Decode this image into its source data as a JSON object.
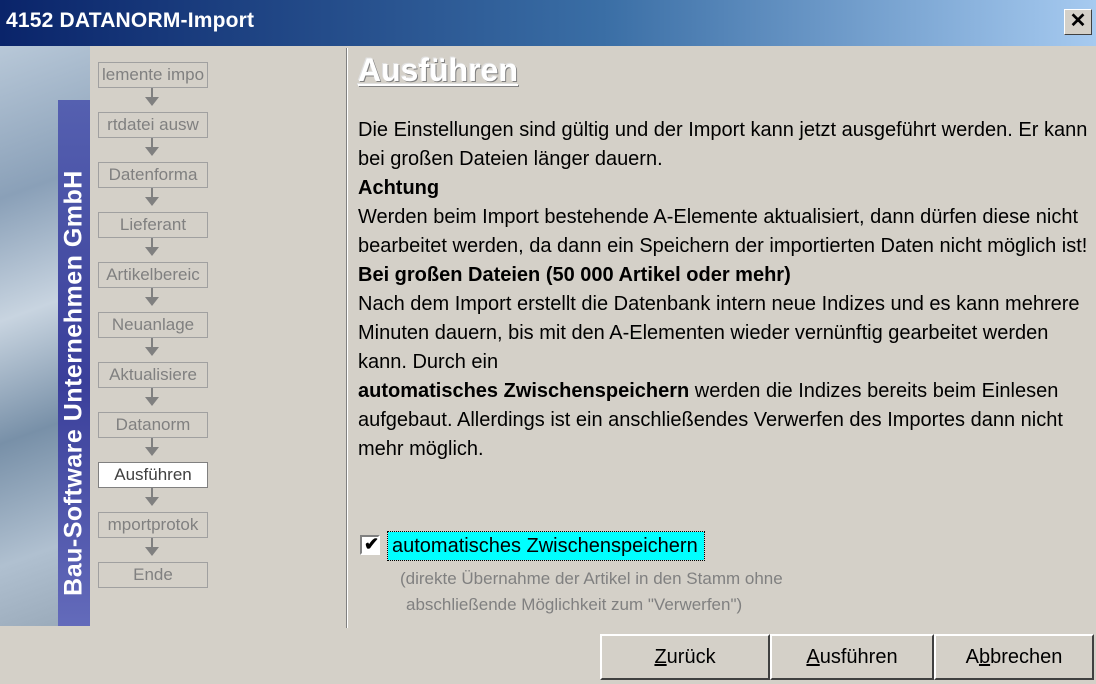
{
  "window": {
    "title": "4152 DATANORM-Import",
    "close_icon": "close-icon"
  },
  "sidebar": {
    "brand_text": "Bau-Software Unternehmen GmbH",
    "steps": [
      {
        "label": "lemente impo",
        "state": "disabled"
      },
      {
        "label": "rtdatei ausw",
        "state": "disabled"
      },
      {
        "label": "Datenforma",
        "state": "disabled"
      },
      {
        "label": "Lieferant",
        "state": "disabled"
      },
      {
        "label": "Artikelbereic",
        "state": "disabled"
      },
      {
        "label": "Neuanlage",
        "state": "disabled"
      },
      {
        "label": "Aktualisiere",
        "state": "disabled"
      },
      {
        "label": "Datanorm",
        "state": "disabled"
      },
      {
        "label": "Ausführen",
        "state": "active"
      },
      {
        "label": "mportprotok",
        "state": "disabled"
      },
      {
        "label": "Ende",
        "state": "disabled"
      }
    ]
  },
  "main": {
    "heading": "Ausführen",
    "para1": "Die Einstellungen sind gültig und der Import kann jetzt ausgeführt werden. Er kann bei großen Dateien länger dauern.",
    "attention_title": "Achtung",
    "para2": "Werden beim Import bestehende A-Elemente aktualisiert, dann dürfen diese nicht bearbeitet werden, da dann ein Speichern der importierten Daten nicht möglich ist!",
    "large_files_title": "Bei großen Dateien (50 000 Artikel oder mehr)",
    "para3_a": "Nach dem Import erstellt die Datenbank intern neue Indizes und es kann mehrere Minuten dauern, bis mit den A-Elementen wieder vernünftig gearbeitet werden kann. Durch ein",
    "para3_bold": "automatisches Zwischenspeichern",
    "para3_b": " werden die Indizes bereits beim Einlesen aufgebaut. Allerdings ist ein anschließendes Verwerfen des Importes dann nicht mehr möglich.",
    "checkbox": {
      "label": "automatisches Zwischenspeichern",
      "checked": true,
      "check_glyph": "✔"
    },
    "hint_line1": "(direkte Übernahme der Artikel in den Stamm ohne",
    "hint_line2": "abschließende Möglichkeit zum  \"Verwerfen\")"
  },
  "buttons": {
    "back": {
      "mnemonic": "Z",
      "rest": "urück"
    },
    "execute": {
      "mnemonic": "A",
      "rest": "usführen"
    },
    "cancel": {
      "pre": "A",
      "mnemonic": "b",
      "rest": "brechen"
    }
  },
  "colors": {
    "title_gradient_start": "#0a246a",
    "title_gradient_end": "#a6caf0",
    "checkbox_highlight": "#00ffff",
    "brand_bar": "#3a3f9a",
    "dialog_face": "#d4d0c8"
  }
}
